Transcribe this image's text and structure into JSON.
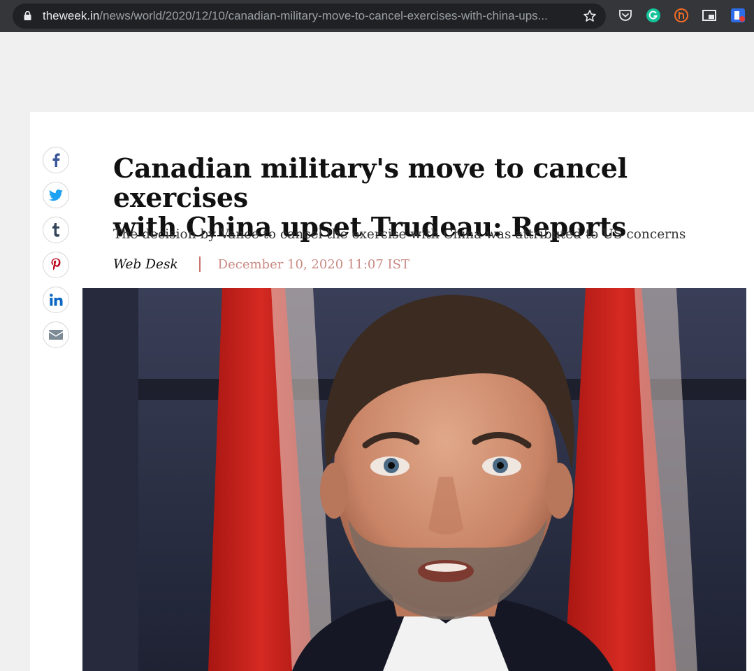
{
  "browser": {
    "url_host": "theweek.in",
    "url_path": "/news/world/2020/12/10/canadian-military-move-to-cancel-exercises-with-china-ups...",
    "icons": [
      "lock-icon",
      "bookmark-star-icon",
      "pocket-icon",
      "grammarly-icon",
      "honey-icon",
      "picture-in-picture-icon",
      "extension-icon"
    ]
  },
  "share": {
    "icons": [
      "facebook-icon",
      "twitter-icon",
      "tumblr-icon",
      "pinterest-icon",
      "linkedin-icon",
      "email-icon"
    ],
    "colors": {
      "facebook": "#3b5998",
      "twitter": "#1da1f2",
      "tumblr": "#35465c",
      "pinterest": "#bd081c",
      "linkedin": "#0a66c2",
      "email": "#7c8b96"
    }
  },
  "article": {
    "headline_line1": "Canadian military's move to cancel exercises",
    "headline_line2": "with China upset Trudeau: Reports",
    "subheadline": "The decision by Vance to cancel the exercise with China was attributed to US concerns",
    "author": "Web Desk",
    "date": "December 10, 2020 11:07 IST"
  },
  "colors": {
    "divider": "#c9736b",
    "date": "#c98a84",
    "chrome": "#35363a"
  }
}
